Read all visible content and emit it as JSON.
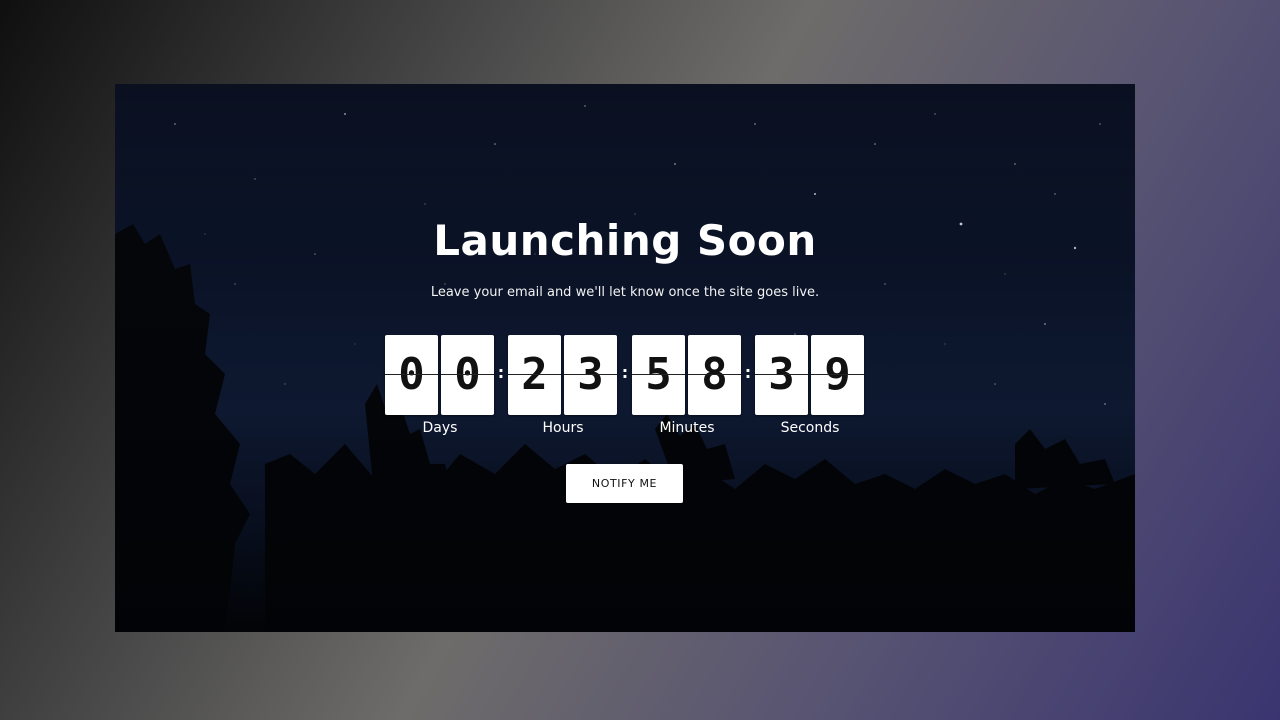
{
  "hero": {
    "title": "Launching Soon",
    "subtitle": "Leave your email and we'll let know once the site goes live."
  },
  "countdown": {
    "days": {
      "digits": [
        "0",
        "0"
      ],
      "label": "Days"
    },
    "hours": {
      "digits": [
        "2",
        "3"
      ],
      "label": "Hours"
    },
    "minutes": {
      "digits": [
        "5",
        "8"
      ],
      "label": "Minutes"
    },
    "seconds": {
      "digits": [
        "3",
        "9"
      ],
      "label": "Seconds"
    },
    "separator": ":"
  },
  "cta": {
    "notify_label": "NOTIFY ME"
  },
  "colors": {
    "card_bg": "#ffffff",
    "digit_text": "#111111",
    "hero_text": "#ffffff",
    "button_bg": "#ffffff",
    "button_text": "#111111"
  }
}
